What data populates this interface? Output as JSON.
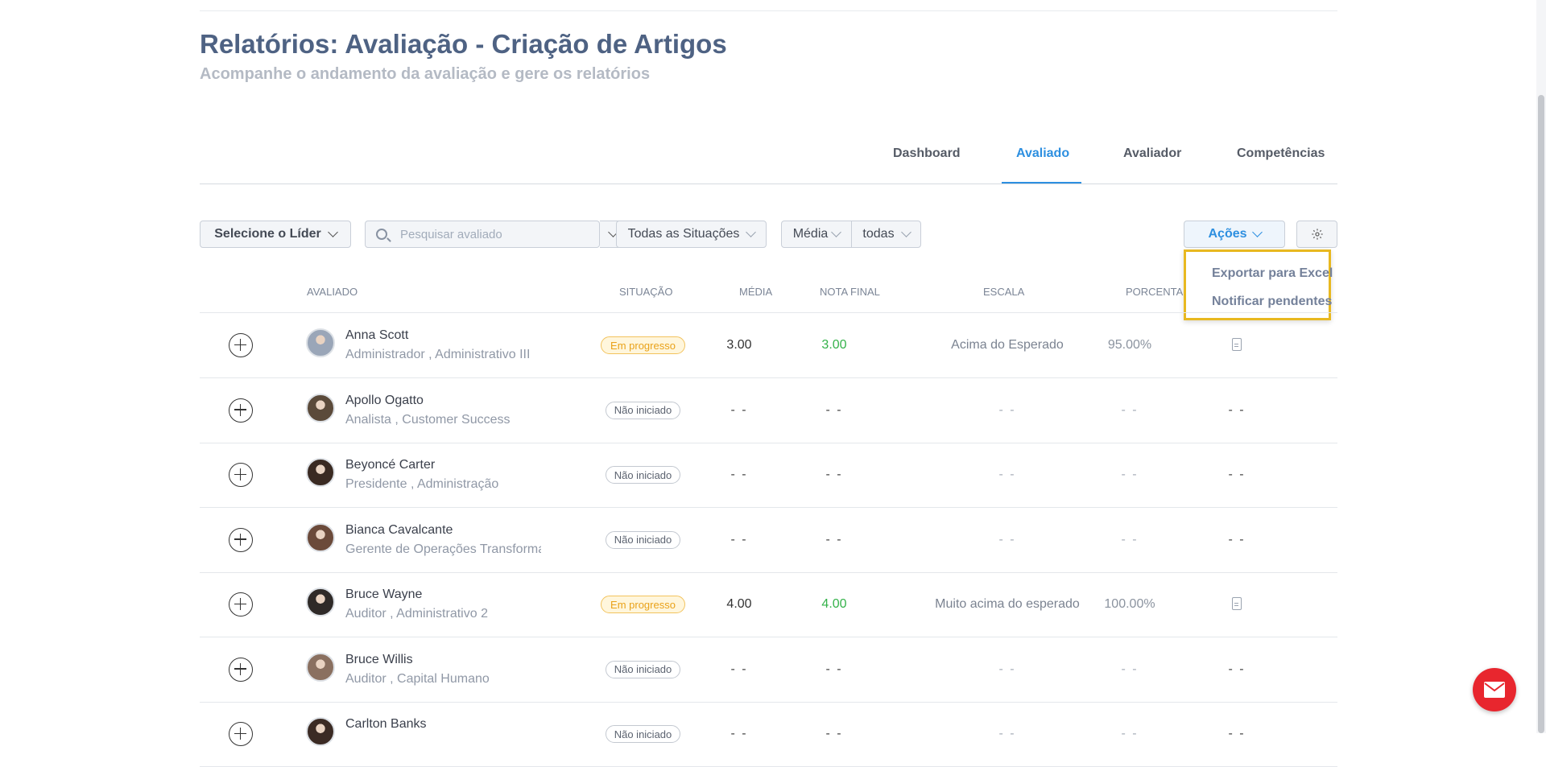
{
  "header": {
    "title": "Relatórios: Avaliação - Criação de Artigos",
    "subtitle": "Acompanhe o andamento da avaliação e gere os relatórios"
  },
  "tabs": [
    {
      "label": "Dashboard",
      "active": false
    },
    {
      "label": "Avaliado",
      "active": true
    },
    {
      "label": "Avaliador",
      "active": false
    },
    {
      "label": "Competências",
      "active": false
    }
  ],
  "filters": {
    "leader_label": "Selecione o Líder",
    "search_placeholder": "Pesquisar avaliado",
    "status_label": "Todas as Situações",
    "media_label": "Média",
    "todas_label": "todas",
    "actions_label": "Ações"
  },
  "actions_menu": [
    {
      "label": "Exportar para Excel",
      "icon": "download-icon"
    },
    {
      "label": "Notificar pendentes",
      "icon": "download-icon"
    }
  ],
  "table": {
    "headers": {
      "avaliado": "AVALIADO",
      "situacao": "SITUAÇÃO",
      "media": "MÉDIA",
      "nota_final": "NOTA FINAL",
      "escala": "ESCALA",
      "porcentagem": "PORCENTA"
    },
    "rows": [
      {
        "name": "Anna Scott",
        "role": "Administrador , Administrativo III",
        "status": "Em progresso",
        "status_type": "progress",
        "media": "3.00",
        "nota": "3.00",
        "escala": "Acima do Esperado",
        "porc": "95.00%",
        "file": true
      },
      {
        "name": "Apollo Ogatto",
        "role": "Analista , Customer Success",
        "status": "Não iniciado",
        "status_type": "notstarted",
        "media": "- -",
        "nota": "- -",
        "escala": "- -",
        "porc": "- -",
        "file": false
      },
      {
        "name": "Beyoncé Carter",
        "role": "Presidente , Administração",
        "status": "Não iniciado",
        "status_type": "notstarted",
        "media": "- -",
        "nota": "- -",
        "escala": "- -",
        "porc": "- -",
        "file": false
      },
      {
        "name": "Bianca Cavalcante",
        "role": "Gerente de Operações Transforma",
        "status": "Não iniciado",
        "status_type": "notstarted",
        "media": "- -",
        "nota": "- -",
        "escala": "- -",
        "porc": "- -",
        "file": false
      },
      {
        "name": "Bruce Wayne",
        "role": "Auditor , Administrativo 2",
        "status": "Em progresso",
        "status_type": "progress",
        "media": "4.00",
        "nota": "4.00",
        "escala": "Muito acima do esperado",
        "porc": "100.00%",
        "file": true
      },
      {
        "name": "Bruce Willis",
        "role": "Auditor , Capital Humano",
        "status": "Não iniciado",
        "status_type": "notstarted",
        "media": "- -",
        "nota": "- -",
        "escala": "- -",
        "porc": "- -",
        "file": false
      },
      {
        "name": "Carlton Banks",
        "role": "",
        "status": "Não iniciado",
        "status_type": "notstarted",
        "media": "- -",
        "nota": "- -",
        "escala": "- -",
        "porc": "- -",
        "file": false
      }
    ],
    "no_file_mark": "- -"
  },
  "colors": {
    "accent": "#2d8fe0",
    "title": "#4e6283",
    "progress_badge": "#e9a21a",
    "score_green": "#34b24a",
    "highlight_border": "#e8b820",
    "chat_button": "#e8262e"
  }
}
